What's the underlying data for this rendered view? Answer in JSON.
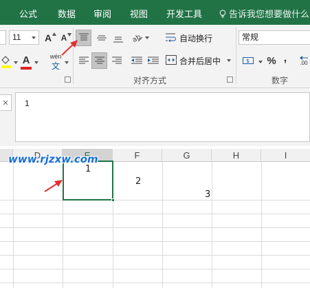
{
  "tabs": [
    "公式",
    "数据",
    "审阅",
    "视图",
    "开发工具"
  ],
  "tell_me": "告诉我您想要做什么...",
  "font": {
    "size_value": "11",
    "grow_label": "A",
    "shrink_label": "A",
    "font_color_label": "A",
    "phonetic_label": "wén"
  },
  "alignment": {
    "wrap_text": "自动换行",
    "merge_center": "合并后居中",
    "group_label": "对齐方式"
  },
  "number": {
    "format_value": "常规",
    "percent": "%",
    "comma": ",",
    "group_label": "数字",
    "decimal_label": ".00"
  },
  "formula_bar": {
    "value": "1"
  },
  "columns": [
    "D",
    "E",
    "F",
    "G",
    "H",
    "I"
  ],
  "cells": {
    "E": "1",
    "F": "2",
    "G": "3"
  },
  "watermark": "www.rjzxw.com",
  "colors": {
    "accent": "#217346",
    "font_color_bar": "#e02020",
    "highlight_bar": "#ffff00",
    "annotation_arrow": "#e03030",
    "watermark": "#1a6fd6"
  }
}
